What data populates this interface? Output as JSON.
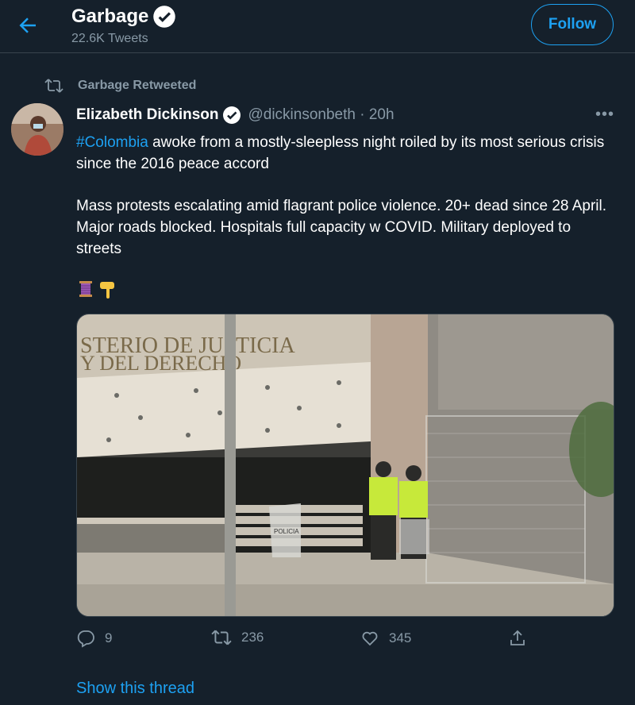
{
  "header": {
    "title": "Garbage",
    "tweet_count": "22.6K Tweets",
    "follow_label": "Follow"
  },
  "tweet": {
    "retweet_label": "Garbage Retweeted",
    "author_name": "Elizabeth Dickinson",
    "author_meta": "@dickinsonbeth · 20h",
    "hashtag": "#Colombia",
    "text_1": " awoke from a mostly-sleepless night roiled by its most serious crisis since the 2016 peace accord",
    "text_2": "Mass protests escalating amid flagrant police violence. 20+ dead since 28 April. Major roads blocked. Hospitals full capacity w COVID. Military deployed to streets",
    "image": {
      "sign_line_1": "STERIO DE JUSTICIA",
      "sign_line_2": "Y DEL DERECHO",
      "shield_text": "POLICIA"
    },
    "actions": {
      "replies": "9",
      "retweets": "236",
      "likes": "345"
    },
    "show_thread": "Show this thread"
  },
  "icons": [
    "back-arrow-icon",
    "verified-badge-icon",
    "retweet-icon",
    "more-icon",
    "thread-emoji-icon",
    "backhand-index-down-emoji-icon",
    "reply-icon",
    "like-icon",
    "share-icon"
  ],
  "colors": {
    "background": "#15202b",
    "accent": "#1da1f2",
    "muted": "#8899a6",
    "divider": "#38444d"
  }
}
